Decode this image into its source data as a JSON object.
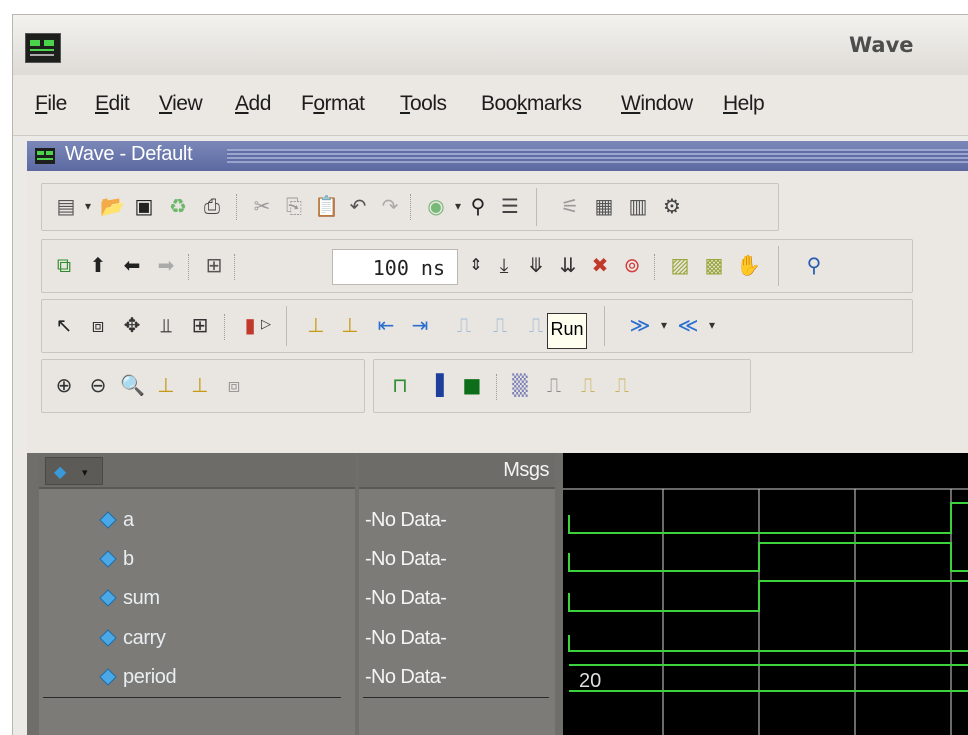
{
  "window": {
    "title": "Wave"
  },
  "menu": [
    {
      "pre": "",
      "u": "F",
      "post": "ile"
    },
    {
      "pre": "",
      "u": "E",
      "post": "dit"
    },
    {
      "pre": "",
      "u": "V",
      "post": "iew"
    },
    {
      "pre": "",
      "u": "A",
      "post": "dd"
    },
    {
      "pre": "F",
      "u": "o",
      "post": "rmat"
    },
    {
      "pre": "",
      "u": "T",
      "post": "ools"
    },
    {
      "pre": "Boo",
      "u": "k",
      "post": "marks"
    },
    {
      "pre": "",
      "u": "W",
      "post": "indow"
    },
    {
      "pre": "",
      "u": "H",
      "post": "elp"
    }
  ],
  "inner_window": {
    "title": "Wave - Default"
  },
  "toolbar": {
    "time_value": "100 ns",
    "tooltip": "Run"
  },
  "wave": {
    "header_values": "Msgs",
    "signals": [
      {
        "name": "a",
        "value": "-No Data-"
      },
      {
        "name": "b",
        "value": "-No Data-"
      },
      {
        "name": "sum",
        "value": "-No Data-"
      },
      {
        "name": "carry",
        "value": "-No Data-"
      },
      {
        "name": "period",
        "value": "-No Data-"
      }
    ],
    "period_display": "20"
  },
  "colors": {
    "wave_green": "#3bd23b",
    "grid": "#cfcfcf",
    "signal_icon": "#3a9ad9"
  }
}
